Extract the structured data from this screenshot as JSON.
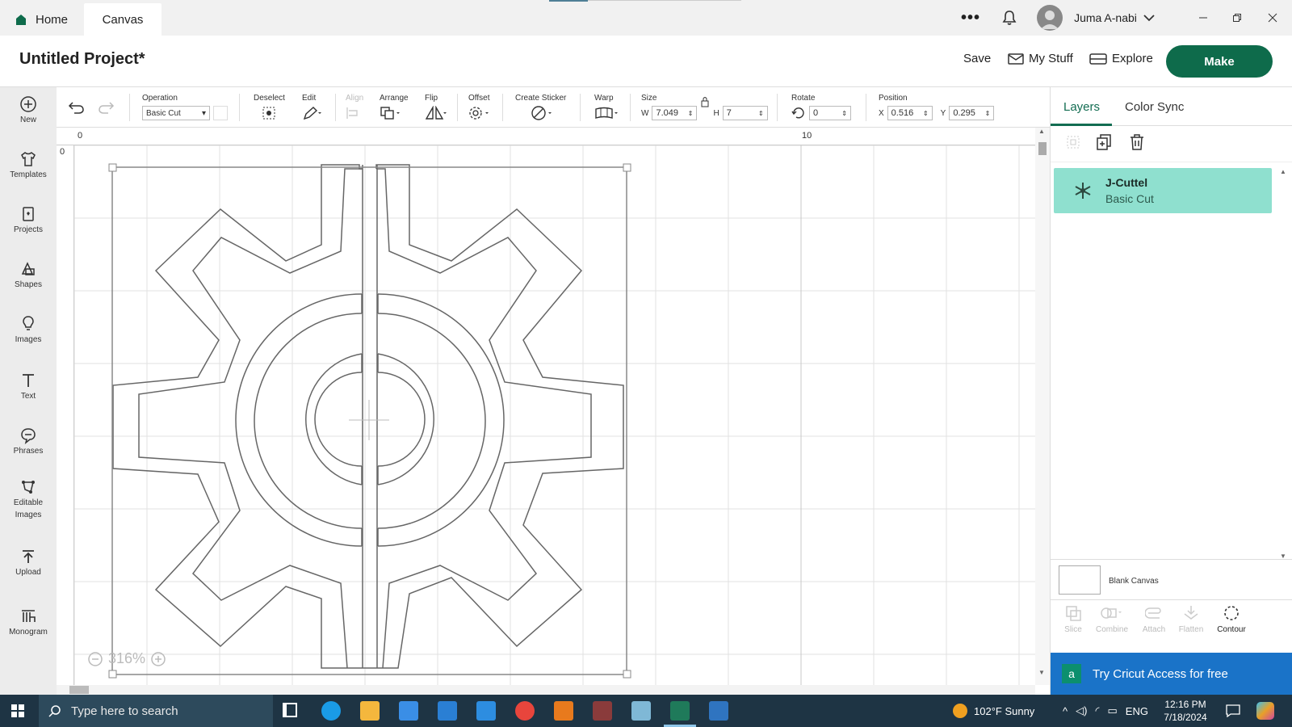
{
  "tabs": {
    "home": "Home",
    "canvas": "Canvas"
  },
  "user": {
    "name": "Juma A-nabi"
  },
  "header": {
    "title": "Untitled Project*",
    "save": "Save",
    "my_stuff": "My Stuff",
    "explore": "Explore",
    "make": "Make"
  },
  "sidebar": {
    "items": [
      {
        "label": "New",
        "icon": "plus-circle-icon"
      },
      {
        "label": "Templates",
        "icon": "shirt-icon"
      },
      {
        "label": "Projects",
        "icon": "projects-icon"
      },
      {
        "label": "Shapes",
        "icon": "shapes-icon"
      },
      {
        "label": "Images",
        "icon": "bulb-icon"
      },
      {
        "label": "Text",
        "icon": "text-icon"
      },
      {
        "label": "Phrases",
        "icon": "speech-bubble-icon"
      },
      {
        "label": "Editable",
        "label2": "Images",
        "icon": "editable-images-icon"
      },
      {
        "label": "Upload",
        "icon": "upload-icon"
      },
      {
        "label": "Monogram",
        "icon": "monogram-icon"
      }
    ]
  },
  "toolbar": {
    "operation_label": "Operation",
    "operation_value": "Basic Cut",
    "deselect": "Deselect",
    "edit": "Edit",
    "align": "Align",
    "arrange": "Arrange",
    "flip": "Flip",
    "offset": "Offset",
    "create_sticker": "Create Sticker",
    "warp": "Warp",
    "size": "Size",
    "w_label": "W",
    "w_value": "7.049",
    "h_label": "H",
    "h_value": "7",
    "rotate": "Rotate",
    "rotate_value": "0",
    "position": "Position",
    "x_label": "X",
    "x_value": "0.516",
    "y_label": "Y",
    "y_value": "0.295"
  },
  "ruler": {
    "top_0": "0",
    "top_10": "10",
    "left_0": "0"
  },
  "zoom": "316%",
  "panel": {
    "tab_layers": "Layers",
    "tab_color_sync": "Color Sync",
    "layer_name": "J-Cuttel",
    "layer_type": "Basic Cut",
    "blank_canvas": "Blank Canvas",
    "actions": [
      "Slice",
      "Combine",
      "Attach",
      "Flatten",
      "Contour"
    ],
    "try_access": "Try Cricut Access for free"
  },
  "taskbar": {
    "search_placeholder": "Type here to search",
    "weather": "102°F  Sunny",
    "lang": "ENG",
    "time": "12:16 PM",
    "date": "7/18/2024"
  },
  "colors": {
    "accent": "#0e6b4b",
    "layer_bg": "#8fe0cf",
    "banner": "#1a73c8",
    "taskbar": "#1e3444"
  }
}
